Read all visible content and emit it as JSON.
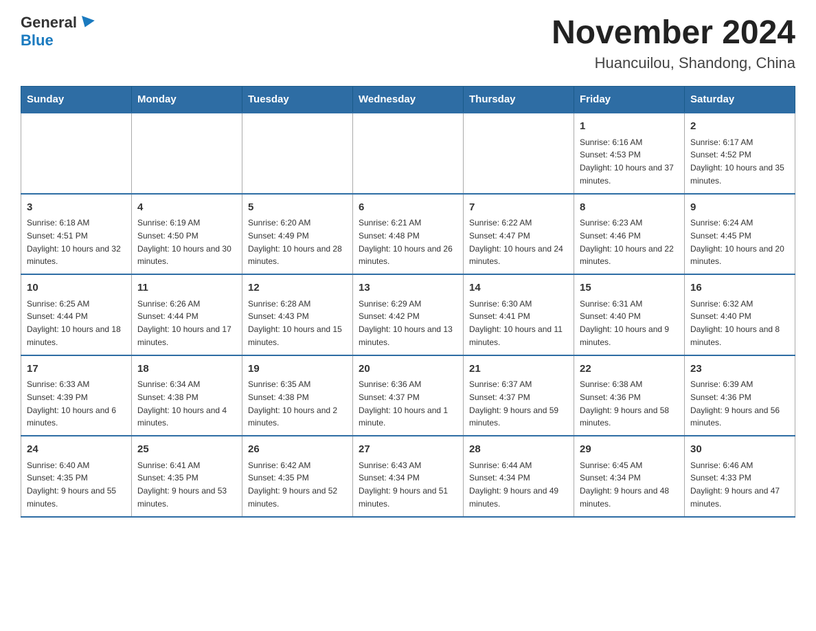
{
  "header": {
    "logo_general": "General",
    "logo_blue": "Blue",
    "month_title": "November 2024",
    "location": "Huancuilou, Shandong, China"
  },
  "weekdays": [
    "Sunday",
    "Monday",
    "Tuesday",
    "Wednesday",
    "Thursday",
    "Friday",
    "Saturday"
  ],
  "weeks": [
    [
      {
        "day": "",
        "info": ""
      },
      {
        "day": "",
        "info": ""
      },
      {
        "day": "",
        "info": ""
      },
      {
        "day": "",
        "info": ""
      },
      {
        "day": "",
        "info": ""
      },
      {
        "day": "1",
        "info": "Sunrise: 6:16 AM\nSunset: 4:53 PM\nDaylight: 10 hours and 37 minutes."
      },
      {
        "day": "2",
        "info": "Sunrise: 6:17 AM\nSunset: 4:52 PM\nDaylight: 10 hours and 35 minutes."
      }
    ],
    [
      {
        "day": "3",
        "info": "Sunrise: 6:18 AM\nSunset: 4:51 PM\nDaylight: 10 hours and 32 minutes."
      },
      {
        "day": "4",
        "info": "Sunrise: 6:19 AM\nSunset: 4:50 PM\nDaylight: 10 hours and 30 minutes."
      },
      {
        "day": "5",
        "info": "Sunrise: 6:20 AM\nSunset: 4:49 PM\nDaylight: 10 hours and 28 minutes."
      },
      {
        "day": "6",
        "info": "Sunrise: 6:21 AM\nSunset: 4:48 PM\nDaylight: 10 hours and 26 minutes."
      },
      {
        "day": "7",
        "info": "Sunrise: 6:22 AM\nSunset: 4:47 PM\nDaylight: 10 hours and 24 minutes."
      },
      {
        "day": "8",
        "info": "Sunrise: 6:23 AM\nSunset: 4:46 PM\nDaylight: 10 hours and 22 minutes."
      },
      {
        "day": "9",
        "info": "Sunrise: 6:24 AM\nSunset: 4:45 PM\nDaylight: 10 hours and 20 minutes."
      }
    ],
    [
      {
        "day": "10",
        "info": "Sunrise: 6:25 AM\nSunset: 4:44 PM\nDaylight: 10 hours and 18 minutes."
      },
      {
        "day": "11",
        "info": "Sunrise: 6:26 AM\nSunset: 4:44 PM\nDaylight: 10 hours and 17 minutes."
      },
      {
        "day": "12",
        "info": "Sunrise: 6:28 AM\nSunset: 4:43 PM\nDaylight: 10 hours and 15 minutes."
      },
      {
        "day": "13",
        "info": "Sunrise: 6:29 AM\nSunset: 4:42 PM\nDaylight: 10 hours and 13 minutes."
      },
      {
        "day": "14",
        "info": "Sunrise: 6:30 AM\nSunset: 4:41 PM\nDaylight: 10 hours and 11 minutes."
      },
      {
        "day": "15",
        "info": "Sunrise: 6:31 AM\nSunset: 4:40 PM\nDaylight: 10 hours and 9 minutes."
      },
      {
        "day": "16",
        "info": "Sunrise: 6:32 AM\nSunset: 4:40 PM\nDaylight: 10 hours and 8 minutes."
      }
    ],
    [
      {
        "day": "17",
        "info": "Sunrise: 6:33 AM\nSunset: 4:39 PM\nDaylight: 10 hours and 6 minutes."
      },
      {
        "day": "18",
        "info": "Sunrise: 6:34 AM\nSunset: 4:38 PM\nDaylight: 10 hours and 4 minutes."
      },
      {
        "day": "19",
        "info": "Sunrise: 6:35 AM\nSunset: 4:38 PM\nDaylight: 10 hours and 2 minutes."
      },
      {
        "day": "20",
        "info": "Sunrise: 6:36 AM\nSunset: 4:37 PM\nDaylight: 10 hours and 1 minute."
      },
      {
        "day": "21",
        "info": "Sunrise: 6:37 AM\nSunset: 4:37 PM\nDaylight: 9 hours and 59 minutes."
      },
      {
        "day": "22",
        "info": "Sunrise: 6:38 AM\nSunset: 4:36 PM\nDaylight: 9 hours and 58 minutes."
      },
      {
        "day": "23",
        "info": "Sunrise: 6:39 AM\nSunset: 4:36 PM\nDaylight: 9 hours and 56 minutes."
      }
    ],
    [
      {
        "day": "24",
        "info": "Sunrise: 6:40 AM\nSunset: 4:35 PM\nDaylight: 9 hours and 55 minutes."
      },
      {
        "day": "25",
        "info": "Sunrise: 6:41 AM\nSunset: 4:35 PM\nDaylight: 9 hours and 53 minutes."
      },
      {
        "day": "26",
        "info": "Sunrise: 6:42 AM\nSunset: 4:35 PM\nDaylight: 9 hours and 52 minutes."
      },
      {
        "day": "27",
        "info": "Sunrise: 6:43 AM\nSunset: 4:34 PM\nDaylight: 9 hours and 51 minutes."
      },
      {
        "day": "28",
        "info": "Sunrise: 6:44 AM\nSunset: 4:34 PM\nDaylight: 9 hours and 49 minutes."
      },
      {
        "day": "29",
        "info": "Sunrise: 6:45 AM\nSunset: 4:34 PM\nDaylight: 9 hours and 48 minutes."
      },
      {
        "day": "30",
        "info": "Sunrise: 6:46 AM\nSunset: 4:33 PM\nDaylight: 9 hours and 47 minutes."
      }
    ]
  ]
}
